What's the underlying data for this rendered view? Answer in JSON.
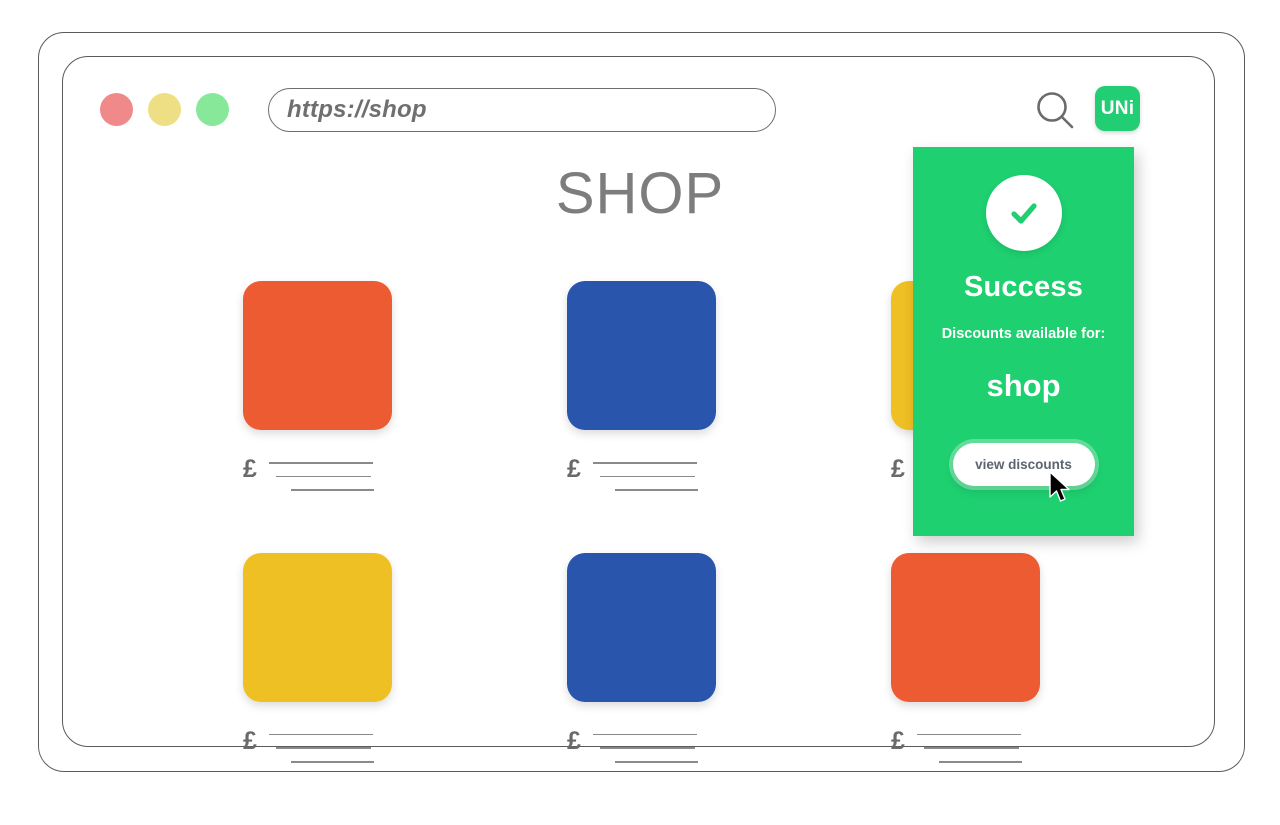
{
  "browser": {
    "dots": [
      {
        "name": "close-dot",
        "color": "#f08a8a"
      },
      {
        "name": "minimize-dot",
        "color": "#efdf84"
      },
      {
        "name": "maximize-dot",
        "color": "#88e89a"
      }
    ],
    "url_value": "https://shop",
    "url_placeholder": "https://shop",
    "search_icon": "search-icon",
    "extension_badge_label": "UNi",
    "extension_badge_color": "#22ce73"
  },
  "page": {
    "title": "SHOP",
    "products": [
      {
        "color": "#ec5b31",
        "price_symbol": "£"
      },
      {
        "color": "#2a55ac",
        "price_symbol": "£"
      },
      {
        "color": "#efc024",
        "price_symbol": "£"
      },
      {
        "color": "#efc024",
        "price_symbol": "£"
      },
      {
        "color": "#2a55ac",
        "price_symbol": "£"
      },
      {
        "color": "#ec5b31",
        "price_symbol": "£"
      }
    ]
  },
  "success_card": {
    "icon": "check-circle-icon",
    "heading": "Success",
    "subtitle": "Discounts available for:",
    "domain": "shop",
    "button_label": "view discounts",
    "background_color": "#1ed070"
  },
  "cursor": {
    "name": "mouse-pointer"
  }
}
